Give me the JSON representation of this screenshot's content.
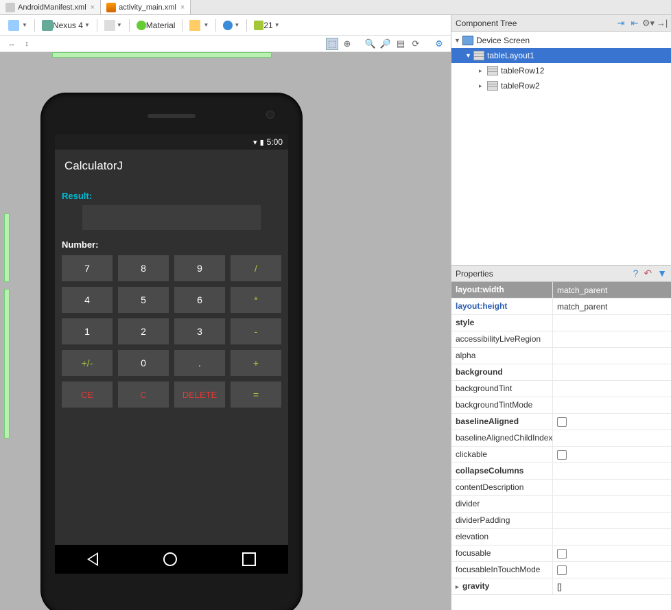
{
  "tabs": [
    {
      "label": "AndroidManifest.xml",
      "active": false
    },
    {
      "label": "activity_main.xml",
      "active": true
    }
  ],
  "toolbar": {
    "device": "Nexus 4",
    "theme": "Material",
    "api": "21"
  },
  "component_tree": {
    "title": "Component Tree",
    "nodes": {
      "root": "Device Screen",
      "table": "tableLayout1",
      "row1": "tableRow12",
      "row2": "tableRow2"
    }
  },
  "properties_panel": {
    "title": "Properties",
    "rows": [
      {
        "name": "layout:width",
        "value": "match_parent",
        "bold": true,
        "selected": true
      },
      {
        "name": "layout:height",
        "value": "match_parent",
        "blue": true
      },
      {
        "name": "style",
        "value": "",
        "bold": true
      },
      {
        "name": "accessibilityLiveRegion",
        "value": ""
      },
      {
        "name": "alpha",
        "value": ""
      },
      {
        "name": "background",
        "value": "",
        "bold": true
      },
      {
        "name": "backgroundTint",
        "value": ""
      },
      {
        "name": "backgroundTintMode",
        "value": ""
      },
      {
        "name": "baselineAligned",
        "value": "",
        "bold": true,
        "check": true
      },
      {
        "name": "baselineAlignedChildIndex",
        "value": ""
      },
      {
        "name": "clickable",
        "value": "",
        "check": true
      },
      {
        "name": "collapseColumns",
        "value": "",
        "bold": true
      },
      {
        "name": "contentDescription",
        "value": ""
      },
      {
        "name": "divider",
        "value": ""
      },
      {
        "name": "dividerPadding",
        "value": ""
      },
      {
        "name": "elevation",
        "value": ""
      },
      {
        "name": "focusable",
        "value": "",
        "check": true
      },
      {
        "name": "focusableInTouchMode",
        "value": "",
        "check": true
      },
      {
        "name": "gravity",
        "value": "[]",
        "bold": true,
        "caret": true
      }
    ]
  },
  "app": {
    "status_time": "5:00",
    "title": "CalculatorJ",
    "result_label": "Result:",
    "number_label": "Number:",
    "keys": [
      {
        "label": "7"
      },
      {
        "label": "8"
      },
      {
        "label": "9"
      },
      {
        "label": "/",
        "cls": "op"
      },
      {
        "label": "4"
      },
      {
        "label": "5"
      },
      {
        "label": "6"
      },
      {
        "label": "*",
        "cls": "op"
      },
      {
        "label": "1"
      },
      {
        "label": "2"
      },
      {
        "label": "3"
      },
      {
        "label": "-",
        "cls": "op"
      },
      {
        "label": "+/-",
        "cls": "op"
      },
      {
        "label": "0"
      },
      {
        "label": "."
      },
      {
        "label": "+",
        "cls": "op"
      },
      {
        "label": "CE",
        "cls": "clr"
      },
      {
        "label": "C",
        "cls": "clr"
      },
      {
        "label": "DELETE",
        "cls": "clr"
      },
      {
        "label": "=",
        "cls": "op"
      }
    ]
  }
}
